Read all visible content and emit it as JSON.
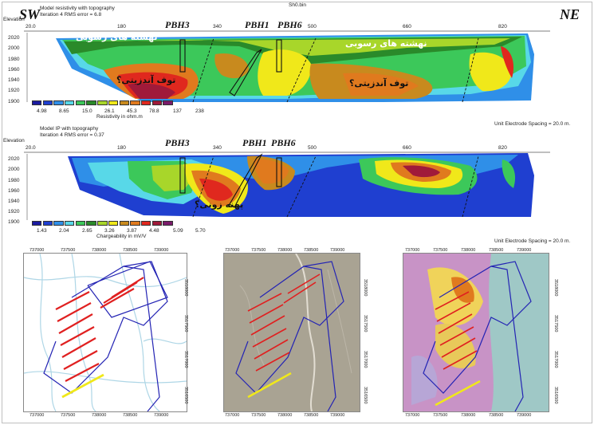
{
  "file_title": "Sh0.bin",
  "corners": {
    "left": "SW",
    "right": "NE"
  },
  "resistivity_section": {
    "model_title": "Model resistivity with topography",
    "iteration": "Iteration 4 RMS error = 6.8",
    "elevation_label": "Elevation",
    "x_ticks": [
      "20.0",
      "180",
      "340",
      "500",
      "660",
      "820"
    ],
    "y_ticks": [
      "2020",
      "2000",
      "1980",
      "1960",
      "1940",
      "1920",
      "1900"
    ],
    "boreholes": [
      "PBH3",
      "PBH1",
      "PBH6"
    ],
    "annotations": [
      "نهشته های رسوبی",
      "نهشته های رسوبی",
      "توف آندزیتی؟",
      "توف آندزیتی؟"
    ],
    "legend_values": [
      "4.98",
      "8.65",
      "15.0",
      "26.1",
      "45.3",
      "78.8",
      "137",
      "238"
    ],
    "legend_colors": [
      "#1a1aa0",
      "#1f3fd0",
      "#2f8fe8",
      "#58d8e8",
      "#3cc85a",
      "#2a8a2a",
      "#a8d62a",
      "#f0e81a",
      "#c88a1e",
      "#e07a1e",
      "#e0281e",
      "#a01a3a",
      "#7a1a6a"
    ],
    "legend_title": "Resistivity in ohm.m",
    "spacing": "Unit Electrode Spacing = 20.0 m."
  },
  "ip_section": {
    "model_title": "Model IP with topography",
    "iteration": "Iteration 4 RMS error = 0.37",
    "elevation_label": "Elevation",
    "x_ticks": [
      "20.0",
      "180",
      "340",
      "500",
      "660",
      "820"
    ],
    "y_ticks": [
      "2020",
      "2000",
      "1980",
      "1960",
      "1940",
      "1920",
      "1900"
    ],
    "boreholes": [
      "PBH3",
      "PBH1",
      "PBH6"
    ],
    "annotations": [
      "پهنه زونی؟"
    ],
    "legend_values": [
      "1.43",
      "2.04",
      "2.65",
      "3.26",
      "3.87",
      "4.48",
      "5.09",
      "5.70"
    ],
    "legend_colors": [
      "#1a1aa0",
      "#1f3fd0",
      "#2f8fe8",
      "#58d8e8",
      "#3cc85a",
      "#2a8a2a",
      "#a8d62a",
      "#f0e81a",
      "#c88a1e",
      "#e07a1e",
      "#e0281e",
      "#a01a3a",
      "#7a1a6a"
    ],
    "legend_title": "Chargeability in mV/V",
    "spacing": "Unit Electrode Spacing = 20.0 m."
  },
  "maps": {
    "x_ticks": [
      "737000",
      "737500",
      "738000",
      "738500",
      "739000"
    ],
    "y_ticks": [
      "3518000",
      "3517500",
      "3517000",
      "3516500"
    ],
    "panels": [
      {
        "name": "topographic-map",
        "background": "#ffffff"
      },
      {
        "name": "satellite-map",
        "background": "#a9a393"
      },
      {
        "name": "anomaly-map",
        "background": "#c893c6"
      }
    ]
  }
}
